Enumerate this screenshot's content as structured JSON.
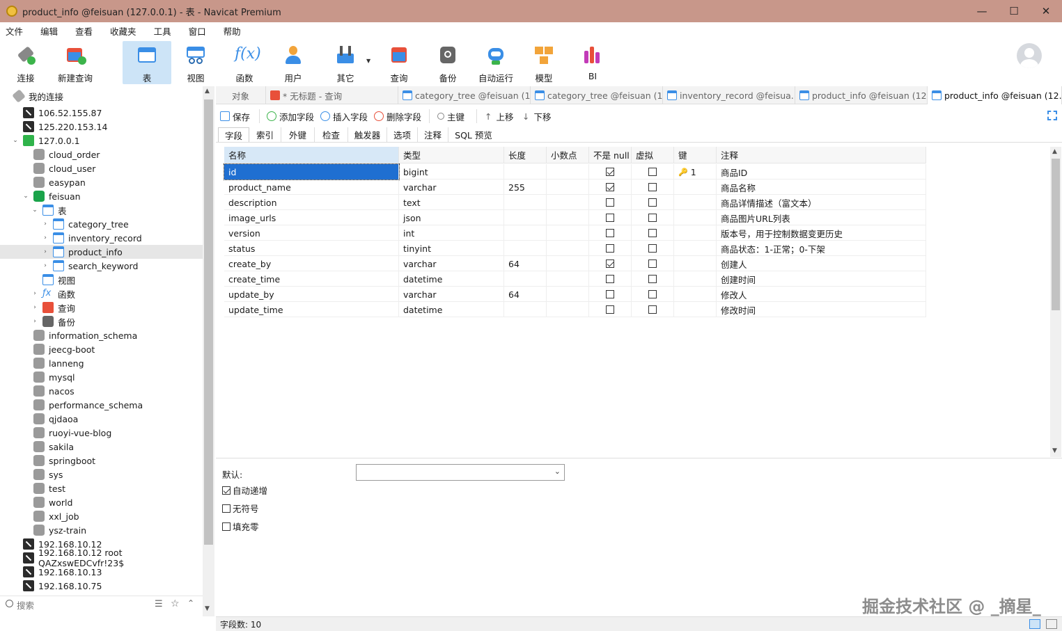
{
  "window": {
    "title": "product_info @feisuan (127.0.0.1) - 表 - Navicat Premium",
    "min": "—",
    "max": "☐",
    "close": "✕"
  },
  "menu": [
    "文件",
    "编辑",
    "查看",
    "收藏夹",
    "工具",
    "窗口",
    "帮助"
  ],
  "toolbar": [
    {
      "label": "连接",
      "icon": "connection-icon"
    },
    {
      "label": "新建查询",
      "icon": "new-query-icon"
    },
    {
      "label": "表",
      "icon": "table-icon",
      "active": true
    },
    {
      "label": "视图",
      "icon": "view-icon"
    },
    {
      "label": "函数",
      "icon": "function-icon"
    },
    {
      "label": "用户",
      "icon": "user-icon"
    },
    {
      "label": "其它",
      "icon": "other-icon"
    },
    {
      "label": "查询",
      "icon": "query-icon"
    },
    {
      "label": "备份",
      "icon": "backup-icon"
    },
    {
      "label": "自动运行",
      "icon": "automation-icon"
    },
    {
      "label": "模型",
      "icon": "model-icon"
    },
    {
      "label": "BI",
      "icon": "bi-icon"
    }
  ],
  "sidebar": {
    "header": "我的连接",
    "items": [
      {
        "label": "106.52.155.87",
        "kind": "server"
      },
      {
        "label": "125.220.153.14",
        "kind": "server"
      },
      {
        "label": "127.0.0.1",
        "kind": "server-open"
      },
      {
        "label": "cloud_order",
        "kind": "db"
      },
      {
        "label": "cloud_user",
        "kind": "db"
      },
      {
        "label": "easypan",
        "kind": "db"
      },
      {
        "label": "feisuan",
        "kind": "db-open"
      },
      {
        "label": "表",
        "kind": "tables"
      },
      {
        "label": "category_tree",
        "kind": "table"
      },
      {
        "label": "inventory_record",
        "kind": "table"
      },
      {
        "label": "product_info",
        "kind": "table",
        "selected": true
      },
      {
        "label": "search_keyword",
        "kind": "table"
      },
      {
        "label": "视图",
        "kind": "views"
      },
      {
        "label": "函数",
        "kind": "functions"
      },
      {
        "label": "查询",
        "kind": "queries"
      },
      {
        "label": "备份",
        "kind": "backups"
      },
      {
        "label": "information_schema",
        "kind": "db"
      },
      {
        "label": "jeecg-boot",
        "kind": "db"
      },
      {
        "label": "lanneng",
        "kind": "db"
      },
      {
        "label": "mysql",
        "kind": "db"
      },
      {
        "label": "nacos",
        "kind": "db"
      },
      {
        "label": "performance_schema",
        "kind": "db"
      },
      {
        "label": "qjdaoa",
        "kind": "db"
      },
      {
        "label": "ruoyi-vue-blog",
        "kind": "db"
      },
      {
        "label": "sakila",
        "kind": "db"
      },
      {
        "label": "springboot",
        "kind": "db"
      },
      {
        "label": "sys",
        "kind": "db"
      },
      {
        "label": "test",
        "kind": "db"
      },
      {
        "label": "world",
        "kind": "db"
      },
      {
        "label": "xxl_job",
        "kind": "db"
      },
      {
        "label": "ysz-train",
        "kind": "db"
      },
      {
        "label": "192.168.10.12",
        "kind": "server"
      },
      {
        "label": "192.168.10.12 root QAZxswEDCvfr!23$",
        "kind": "server"
      },
      {
        "label": "192.168.10.13",
        "kind": "server"
      },
      {
        "label": "192.168.10.75",
        "kind": "server"
      }
    ],
    "search_placeholder": "搜索"
  },
  "tabs": [
    {
      "label": "对象"
    },
    {
      "label": "* 无标题 - 查询"
    },
    {
      "label": "category_tree @feisuan (1..."
    },
    {
      "label": "category_tree @feisuan (1..."
    },
    {
      "label": "inventory_record @feisua..."
    },
    {
      "label": "product_info @feisuan (12..."
    },
    {
      "label": "product_info @feisuan (12...",
      "active": true
    }
  ],
  "actions": [
    "保存",
    "添加字段",
    "插入字段",
    "删除字段",
    "主键",
    "上移",
    "下移"
  ],
  "subtabs": [
    "字段",
    "索引",
    "外键",
    "检查",
    "触发器",
    "选项",
    "注释",
    "SQL 预览"
  ],
  "grid": {
    "headers": [
      "名称",
      "类型",
      "长度",
      "小数点",
      "不是 null",
      "虚拟",
      "键",
      "注释"
    ],
    "rows": [
      {
        "name": "id",
        "type": "bigint",
        "len": "",
        "dec": "",
        "notnull": true,
        "virtual": false,
        "key": "1",
        "comment": "商品ID"
      },
      {
        "name": "product_name",
        "type": "varchar",
        "len": "255",
        "dec": "",
        "notnull": true,
        "virtual": false,
        "key": "",
        "comment": "商品名称"
      },
      {
        "name": "description",
        "type": "text",
        "len": "",
        "dec": "",
        "notnull": false,
        "virtual": false,
        "key": "",
        "comment": "商品详情描述（富文本）"
      },
      {
        "name": "image_urls",
        "type": "json",
        "len": "",
        "dec": "",
        "notnull": false,
        "virtual": false,
        "key": "",
        "comment": "商品图片URL列表"
      },
      {
        "name": "version",
        "type": "int",
        "len": "",
        "dec": "",
        "notnull": false,
        "virtual": false,
        "key": "",
        "comment": "版本号，用于控制数据变更历史"
      },
      {
        "name": "status",
        "type": "tinyint",
        "len": "",
        "dec": "",
        "notnull": false,
        "virtual": false,
        "key": "",
        "comment": "商品状态：1-正常；0-下架"
      },
      {
        "name": "create_by",
        "type": "varchar",
        "len": "64",
        "dec": "",
        "notnull": true,
        "virtual": false,
        "key": "",
        "comment": "创建人"
      },
      {
        "name": "create_time",
        "type": "datetime",
        "len": "",
        "dec": "",
        "notnull": false,
        "virtual": false,
        "key": "",
        "comment": "创建时间"
      },
      {
        "name": "update_by",
        "type": "varchar",
        "len": "64",
        "dec": "",
        "notnull": false,
        "virtual": false,
        "key": "",
        "comment": "修改人"
      },
      {
        "name": "update_time",
        "type": "datetime",
        "len": "",
        "dec": "",
        "notnull": false,
        "virtual": false,
        "key": "",
        "comment": "修改时间"
      }
    ]
  },
  "props": {
    "default_label": "默认:",
    "default_value": "",
    "auto_increment": {
      "label": "自动递增",
      "checked": true
    },
    "unsigned": {
      "label": "无符号",
      "checked": false
    },
    "zerofill": {
      "label": "填充零",
      "checked": false
    }
  },
  "status": {
    "field_count": "字段数: 10"
  },
  "watermark": "掘金技术社区 @ _摘星_"
}
